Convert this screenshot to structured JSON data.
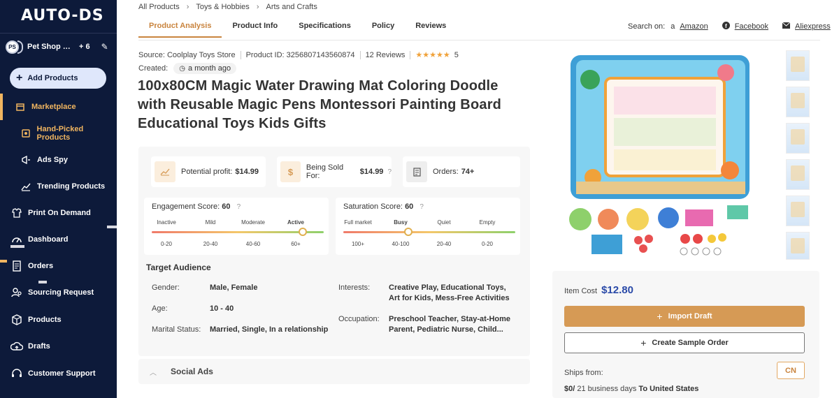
{
  "sidebar": {
    "logo": "AUTO-DS",
    "shop": {
      "avatar": "PS",
      "name": "Pet Shop Dis...",
      "count": "+ 6"
    },
    "add_products": "Add Products",
    "items": [
      {
        "label": "Marketplace"
      },
      {
        "label": "Hand-Picked Products"
      },
      {
        "label": "Ads Spy"
      },
      {
        "label": "Trending Products"
      },
      {
        "label": "Print On Demand"
      },
      {
        "label": "Dashboard"
      },
      {
        "label": "Orders"
      },
      {
        "label": "Sourcing Request"
      },
      {
        "label": "Products"
      },
      {
        "label": "Drafts"
      },
      {
        "label": "Customer Support"
      }
    ]
  },
  "breadcrumb": [
    "All Products",
    "Toys & Hobbies",
    "Arts and Crafts"
  ],
  "tabs": [
    "Product Analysis",
    "Product Info",
    "Specifications",
    "Policy",
    "Reviews"
  ],
  "search_on": {
    "label": "Search on:",
    "links": [
      "Amazon",
      "Facebook",
      "Aliexpress"
    ]
  },
  "product": {
    "source": "Source: Coolplay Toys Store",
    "product_id": "Product ID: 3256807143560874",
    "reviews": "12 Reviews",
    "rating": "5",
    "created_label": "Created:",
    "created_value": "a month ago",
    "title": "100x80CM Magic Water Drawing Mat Coloring Doodle with Reusable Magic Pens Montessori Painting Board Educational Toys Kids Gifts"
  },
  "stats": {
    "profit_label": "Potential profit:",
    "profit_value": "$14.99",
    "sold_label": "Being Sold For:",
    "sold_value": "$14.99",
    "orders_label": "Orders:",
    "orders_value": "74+"
  },
  "engagement": {
    "label": "Engagement Score:",
    "value": "60",
    "levels": [
      "Inactive",
      "Mild",
      "Moderate",
      "Active"
    ],
    "ranges": [
      "0-20",
      "20-40",
      "40-60",
      "60+"
    ],
    "level": 0.88
  },
  "saturation": {
    "label": "Saturation Score:",
    "value": "60",
    "levels": [
      "Full market",
      "Busy",
      "Quiet",
      "Empty"
    ],
    "ranges": [
      "100+",
      "40-100",
      "20-40",
      "0-20"
    ],
    "level": 0.38
  },
  "audience": {
    "title": "Target Audience",
    "gender_label": "Gender:",
    "gender": "Male, Female",
    "age_label": "Age:",
    "age": "10 - 40",
    "marital_label": "Marital Status:",
    "marital": "Married, Single, In a relationship",
    "interests_label": "Interests:",
    "interests": "Creative Play, Educational Toys, Art for Kids, Mess-Free Activities",
    "occupation_label": "Occupation:",
    "occupation": "Preschool Teacher, Stay-at-Home Parent, Pediatric Nurse, Child..."
  },
  "social_ads": "Social Ads",
  "buy": {
    "item_cost_label": "Item Cost",
    "item_cost": "$12.80",
    "import_draft": "Import Draft",
    "create_sample": "Create Sample Order",
    "ships_from": "Ships from:",
    "country": "CN",
    "shipping_cost": "$0/",
    "shipping_days": "21 business days",
    "shipping_to": "To United States"
  },
  "colors": {
    "sidebar": "#0d1a3a",
    "accent": "#c9843e",
    "price": "#2a4aa8"
  }
}
